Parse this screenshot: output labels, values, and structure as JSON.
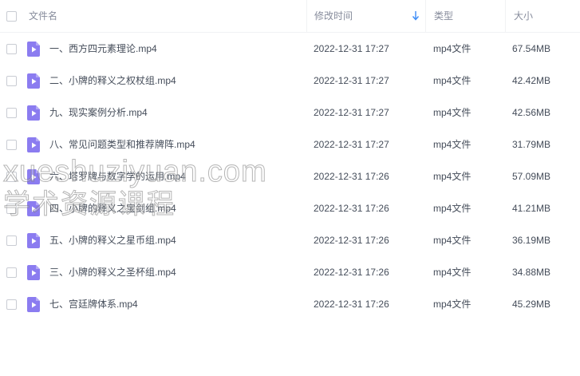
{
  "header": {
    "name_label": "文件名",
    "mtime_label": "修改时间",
    "type_label": "类型",
    "size_label": "大小"
  },
  "files": [
    {
      "name": "一、西方四元素理论.mp4",
      "mtime": "2022-12-31 17:27",
      "type": "mp4文件",
      "size": "67.54MB"
    },
    {
      "name": "二、小牌的释义之权杖组.mp4",
      "mtime": "2022-12-31 17:27",
      "type": "mp4文件",
      "size": "42.42MB"
    },
    {
      "name": "九、现实案例分析.mp4",
      "mtime": "2022-12-31 17:27",
      "type": "mp4文件",
      "size": "42.56MB"
    },
    {
      "name": "八、常见问题类型和推荐牌阵.mp4",
      "mtime": "2022-12-31 17:27",
      "type": "mp4文件",
      "size": "31.79MB"
    },
    {
      "name": "六、塔罗牌与数字学的运用.mp4",
      "mtime": "2022-12-31 17:26",
      "type": "mp4文件",
      "size": "57.09MB"
    },
    {
      "name": "四、小牌的释义之宝剑组.mp4",
      "mtime": "2022-12-31 17:26",
      "type": "mp4文件",
      "size": "41.21MB"
    },
    {
      "name": "五、小牌的释义之星币组.mp4",
      "mtime": "2022-12-31 17:26",
      "type": "mp4文件",
      "size": "36.19MB"
    },
    {
      "name": "三、小牌的释义之圣杯组.mp4",
      "mtime": "2022-12-31 17:26",
      "type": "mp4文件",
      "size": "34.88MB"
    },
    {
      "name": "七、宫廷牌体系.mp4",
      "mtime": "2022-12-31 17:26",
      "type": "mp4文件",
      "size": "45.29MB"
    }
  ],
  "watermark": {
    "line1": "xueshuziyuan.com",
    "line2": "学术资源课程"
  },
  "colors": {
    "accent": "#3b8cf7",
    "file_icon": "#8b7cf0",
    "text": "#454d5a",
    "header_text": "#878c9c"
  }
}
